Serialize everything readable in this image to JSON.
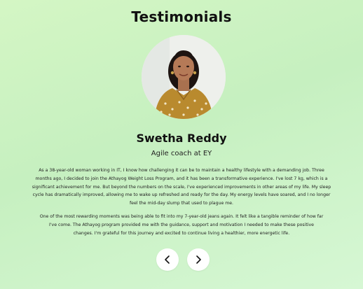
{
  "section": {
    "heading": "Testimonials"
  },
  "testimonial": {
    "name": "Swetha Reddy",
    "role": "Agile coach at EY",
    "paragraphs": [
      "As a 38-year-old woman working in IT, I know how challenging it can be to maintain a healthy lifestyle with a demanding job. Three months ago, I decided to join the Athayog Weight Loss Program, and it has been a transformative experience. I've lost 7 kg, which is a significant achievement for me. But beyond the numbers on the scale, I've experienced improvements in other areas of my life. My sleep cycle has dramatically improved, allowing me to wake up refreshed and ready for the day. My energy levels have soared, and I no longer feel the mid-day slump that used to plague me.",
      "One of the most rewarding moments was being able to fit into my 7-year-old jeans again. It felt like a tangible reminder of how far I've come. The Athayog program provided me with the guidance, support and motivation I needed to make these positive changes. I'm grateful for this journey and excited to continue living a healthier, more energetic life."
    ]
  },
  "navigation": {
    "prev_icon": "chevron-left-icon",
    "next_icon": "chevron-right-icon"
  },
  "colors": {
    "background": "#ccf3c2",
    "button": "#ffffff",
    "text": "#111111"
  }
}
